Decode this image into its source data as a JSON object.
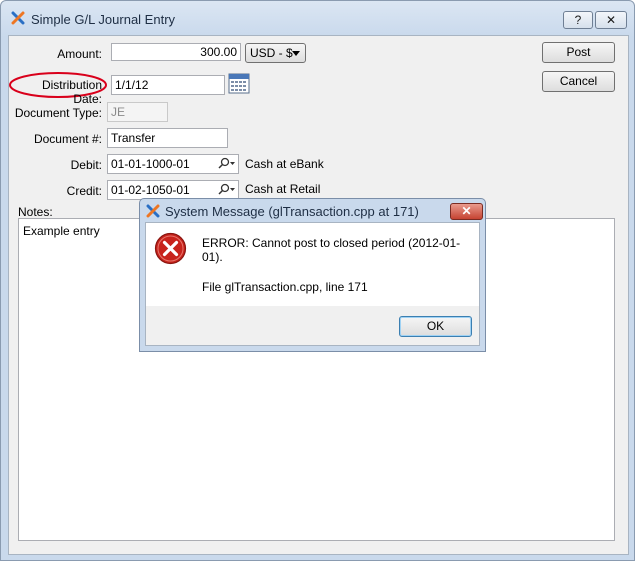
{
  "window": {
    "title": "Simple G/L Journal Entry",
    "help_button": "?",
    "close_button": "✕"
  },
  "form": {
    "amount_label": "Amount:",
    "amount_value": "300.00",
    "currency_value": "USD - $",
    "distribution_date_label": "Distribution Date:",
    "distribution_date_value": "1/1/12",
    "document_type_label": "Document Type:",
    "document_type_value": "JE",
    "document_number_label": "Document #:",
    "document_number_value": "Transfer",
    "debit_label": "Debit:",
    "debit_account": "01-01-1000-01",
    "debit_description": "Cash at eBank",
    "credit_label": "Credit:",
    "credit_account": "01-02-1050-01",
    "credit_description": "Cash at Retail",
    "notes_label": "Notes:",
    "notes_value": "Example entry"
  },
  "buttons": {
    "post": "Post",
    "cancel": "Cancel"
  },
  "dialog": {
    "title": "System Message (glTransaction.cpp at 171)",
    "error_text": "ERROR:  Cannot post to closed period (2012-01-01).",
    "file_text": "File glTransaction.cpp, line 171",
    "ok_button": "OK",
    "close_button": "✕"
  },
  "colors": {
    "highlight_ellipse": "#d9001b",
    "error_icon": "#c8231c",
    "logo_orange": "#ee7623",
    "logo_blue": "#2a6fc4"
  }
}
